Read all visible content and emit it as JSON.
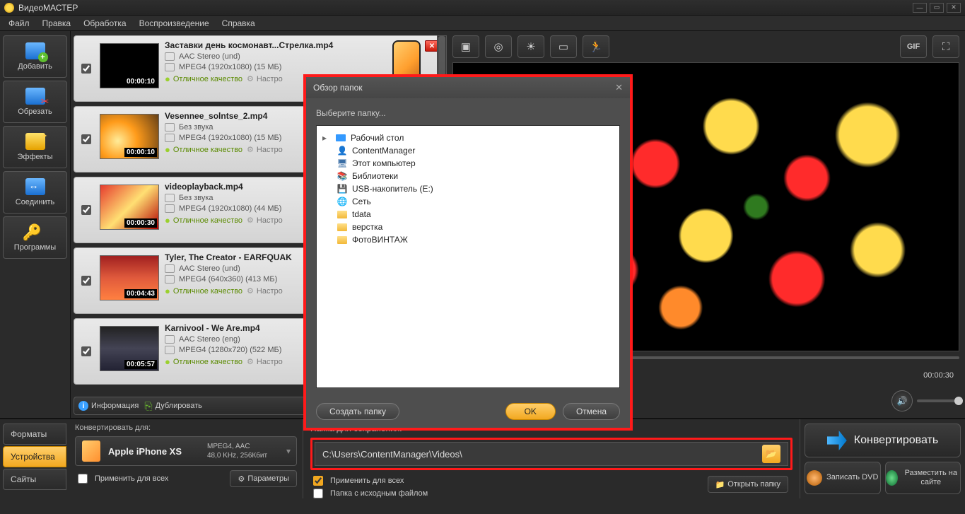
{
  "app": {
    "title": "ВидеоМАСТЕР"
  },
  "menu": [
    "Файл",
    "Правка",
    "Обработка",
    "Воспроизведение",
    "Справка"
  ],
  "sidebar": {
    "add": "Добавить",
    "cut": "Обрезать",
    "effects": "Эффекты",
    "join": "Соединить",
    "programs": "Программы"
  },
  "items": [
    {
      "name": "Заставки день космонавт...Стрелка.mp4",
      "audio": "AAC Stereo (und)",
      "video": "MPEG4 (1920x1080) (15 МБ)",
      "quality": "Отличное качество",
      "settings": "Настро",
      "duration": "00:00:10",
      "thumb": "black",
      "phone": true,
      "close": true
    },
    {
      "name": "Vesennee_solntse_2.mp4",
      "audio": "Без звука",
      "video": "MPEG4 (1920x1080) (15 МБ)",
      "quality": "Отличное качество",
      "settings": "Настро",
      "duration": "00:00:10",
      "thumb": "sunset"
    },
    {
      "name": "videoplayback.mp4",
      "audio": "Без звука",
      "video": "MPEG4 (1920x1080) (44 МБ)",
      "quality": "Отличное качество",
      "settings": "Настро",
      "duration": "00:00:30",
      "thumb": "food"
    },
    {
      "name": "Tyler, The Creator - EARFQUAK",
      "audio": "AAC Stereo (und)",
      "video": "MPEG4 (640x360) (413 МБ)",
      "quality": "Отличное качество",
      "settings": "Настро",
      "duration": "00:04:43",
      "thumb": "concert"
    },
    {
      "name": "Karnivool - We Are.mp4",
      "audio": "AAC Stereo (eng)",
      "video": "MPEG4 (1280x720) (522 МБ)",
      "quality": "Отличное качество",
      "settings": "Настро",
      "duration": "00:05:57",
      "thumb": "dark"
    }
  ],
  "listbar": {
    "info": "Информация",
    "dup": "Дублировать"
  },
  "preview": {
    "time": "00:00:30",
    "gif": "GIF"
  },
  "bottom": {
    "tabs": {
      "formats": "Форматы",
      "devices": "Устройства",
      "sites": "Сайты"
    },
    "convert_label": "Конвертировать для:",
    "device": {
      "name": "Apple iPhone XS",
      "fmt1": "MPEG4, AAC",
      "fmt2": "48,0 KHz, 256Кбит"
    },
    "apply_all": "Применить для всех",
    "params": "Параметры",
    "folder_label": "Папка для сохранения:",
    "path": "C:\\Users\\ContentManager\\Videos\\",
    "apply_all2": "Применить для всех",
    "source_folder": "Папка с исходным файлом",
    "open_folder": "Открыть папку",
    "convert": "Конвертировать",
    "burn": "Записать DVD",
    "publish": "Разместить на сайте"
  },
  "dialog": {
    "title": "Обзор папок",
    "subtitle": "Выберите папку...",
    "tree": [
      {
        "label": "Рабочий стол",
        "icon": "desk",
        "level": 1
      },
      {
        "label": "ContentManager",
        "icon": "user",
        "level": 2
      },
      {
        "label": "Этот компьютер",
        "icon": "pc",
        "level": 2
      },
      {
        "label": "Библиотеки",
        "icon": "lib",
        "level": 2
      },
      {
        "label": "USB-накопитель (E:)",
        "icon": "usb",
        "level": 2
      },
      {
        "label": "Сеть",
        "icon": "net",
        "level": 2
      },
      {
        "label": "tdata",
        "icon": "folder",
        "level": 2
      },
      {
        "label": "верстка",
        "icon": "folder",
        "level": 2
      },
      {
        "label": "ФотоВИНТАЖ",
        "icon": "folder",
        "level": 2
      }
    ],
    "create": "Создать папку",
    "ok": "OK",
    "cancel": "Отмена"
  }
}
